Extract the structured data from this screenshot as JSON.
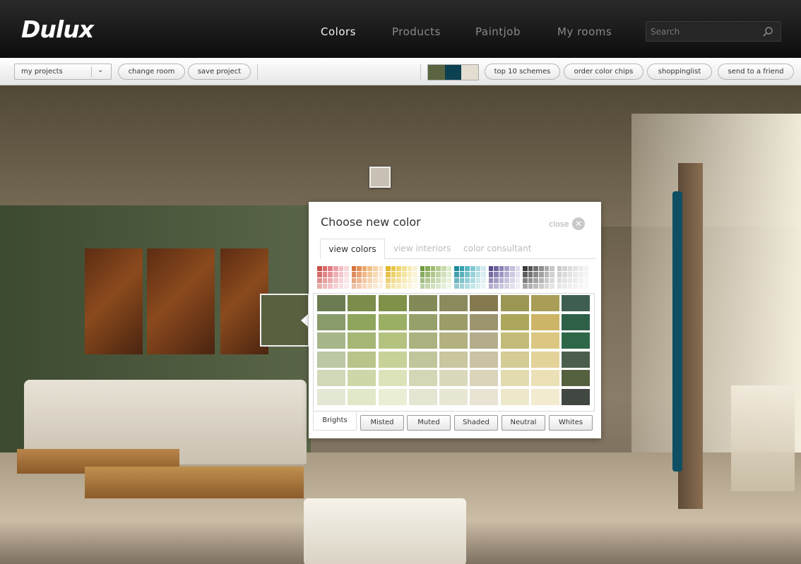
{
  "header": {
    "logo": "Dulux",
    "nav": [
      {
        "label": "Colors",
        "active": true
      },
      {
        "label": "Products",
        "active": false
      },
      {
        "label": "Paintjob",
        "active": false
      },
      {
        "label": "My rooms",
        "active": false
      }
    ],
    "search": {
      "placeholder": "Search",
      "value": ""
    }
  },
  "toolbar": {
    "projects_select": "my projects",
    "change_room": "change room",
    "save_project": "save project",
    "scheme_colors": [
      "#5a6440",
      "#0c4152",
      "#e3ddd2"
    ],
    "top10": "top 10 schemes",
    "order_chips": "order color chips",
    "shoppinglist": "shoppinglist",
    "send_friend": "send to a friend"
  },
  "selected_color": "#58603f",
  "wall_chip_color": "#c9c0b5",
  "dialog": {
    "title": "Choose new color",
    "close": "close",
    "tabs": [
      "view colors",
      "view interiors",
      "color consultant"
    ],
    "family_groups": [
      [
        "#c8504a",
        "#d8696a",
        "#e27b84",
        "#ea9fa5",
        "#f0bcc2",
        "#f6d6da"
      ],
      [
        "#d9733b",
        "#e58d52",
        "#eca86c",
        "#f1bf87",
        "#f5d2a6",
        "#f8e3c6"
      ],
      [
        "#e0b62a",
        "#e8c64b",
        "#eed46e",
        "#f2e08f",
        "#f6eab2",
        "#f9f2d1"
      ],
      [
        "#6f9a3e",
        "#86aa55",
        "#9dbb71",
        "#b3cb8f",
        "#c8dbac",
        "#dde9cb"
      ],
      [
        "#1c8a9c",
        "#34a0ad",
        "#57b5bf",
        "#7fc8cf",
        "#a9dadf",
        "#cfeaed"
      ],
      [
        "#5a4a8c",
        "#6f63a0",
        "#8980b4",
        "#a59fc8",
        "#c2bedb",
        "#dedbed"
      ],
      [
        "#3a3a3a",
        "#555555",
        "#707070",
        "#8d8d8d",
        "#aaaaaa",
        "#c6c6c6"
      ],
      [
        "#c9c9c9",
        "#d4d4d4",
        "#dddddd",
        "#e5e5e5",
        "#ececec",
        "#f3f3f3"
      ]
    ],
    "grid": [
      [
        "#6c7c52",
        "#7b8c4b",
        "#80914a",
        "#838a58",
        "#8a8a5c",
        "#857a4f",
        "#9b9653",
        "#a99d57",
        "#3e5e50"
      ],
      [
        "#899a6b",
        "#8fa55d",
        "#9baf64",
        "#96a06a",
        "#9b9c68",
        "#9d9470",
        "#ada75b",
        "#cdb567",
        "#2e6048"
      ],
      [
        "#a7b68a",
        "#a5b675",
        "#b4c27f",
        "#acb27f",
        "#b3b17f",
        "#b4ac8a",
        "#c3ba77",
        "#dbc782",
        "#2d6747"
      ],
      [
        "#bcc7a3",
        "#b7c58a",
        "#c7d298",
        "#c2c49b",
        "#c9c6a0",
        "#cbc1a3",
        "#d4cb95",
        "#e3d39a",
        "#4b5e4d"
      ],
      [
        "#d0d8b8",
        "#cdd8a8",
        "#dce3ba",
        "#d5d6b6",
        "#dbd9bc",
        "#dbd4ba",
        "#e2dbb0",
        "#ece0b7",
        "#55603f"
      ],
      [
        "#e2e8d3",
        "#e0e8c9",
        "#e9eed5",
        "#e4e6d2",
        "#e8e7d4",
        "#e8e3d2",
        "#eee8cb",
        "#f3ebcf",
        "#414842"
      ]
    ],
    "families": [
      "Brights",
      "Misted",
      "Muted",
      "Shaded",
      "Neutral",
      "Whites"
    ]
  }
}
